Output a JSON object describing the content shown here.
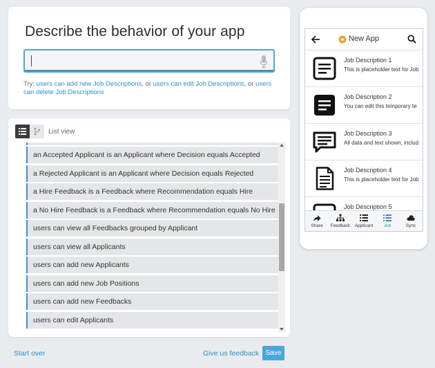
{
  "describe": {
    "title": "Describe the behavior of your app",
    "input_value": "",
    "try_prefix": "Try:",
    "try_sep1": ", or",
    "try_sep2": ", or",
    "suggestions": [
      "users can add new Job Descriptions",
      "users can edit Job Descriptions",
      "users can delete Job Descriptions"
    ]
  },
  "list": {
    "view_label": "List view",
    "rules": [
      "an Accepted Applicant is an Applicant where Decision equals Accepted",
      "a Rejected Applicant is an Applicant where Decision equals Rejected",
      "a Hire Feedback is a Feedback where Recommendation equals Hire",
      "a No Hire Feedback is a Feedback where Recommendation equals No Hire",
      "users can view all Feedbacks grouped by Applicant",
      "users can view all Applicants",
      "users can add new Applicants",
      "users can add new Job Positions",
      "users can add new Feedbacks",
      "users can edit Applicants"
    ]
  },
  "phone": {
    "app_title": "New App",
    "items": [
      {
        "title": "Job Description 1",
        "desc": "This is placeholder text for Job",
        "icon": "document-lines-icon"
      },
      {
        "title": "Job Description 2",
        "desc": "You can edit this temporary te",
        "icon": "document-filled-icon"
      },
      {
        "title": "Job Description 3",
        "desc": "All data and text shown, includ",
        "icon": "chat-bubble-icon"
      },
      {
        "title": "Job Description 4",
        "desc": "This is placeholder text for Job",
        "icon": "page-lines-icon"
      },
      {
        "title": "Job Description 5",
        "desc": "",
        "icon": "document-lines-icon"
      }
    ],
    "tabs": [
      {
        "label": "Share",
        "icon": "share-icon"
      },
      {
        "label": "Feedback",
        "icon": "hierarchy-icon"
      },
      {
        "label": "Applicant",
        "icon": "list-icon"
      },
      {
        "label": "Job",
        "icon": "list-icon"
      },
      {
        "label": "Sync",
        "icon": "cloud-icon"
      }
    ],
    "active_tab": "Job"
  },
  "footer": {
    "start_over": "Start over",
    "feedback": "Give us feedback",
    "save": "Save"
  },
  "colors": {
    "accent": "#4aa7d8",
    "link": "#2f8fc8",
    "rule_border": "#3a8fcf",
    "background": "#e9ecef"
  }
}
